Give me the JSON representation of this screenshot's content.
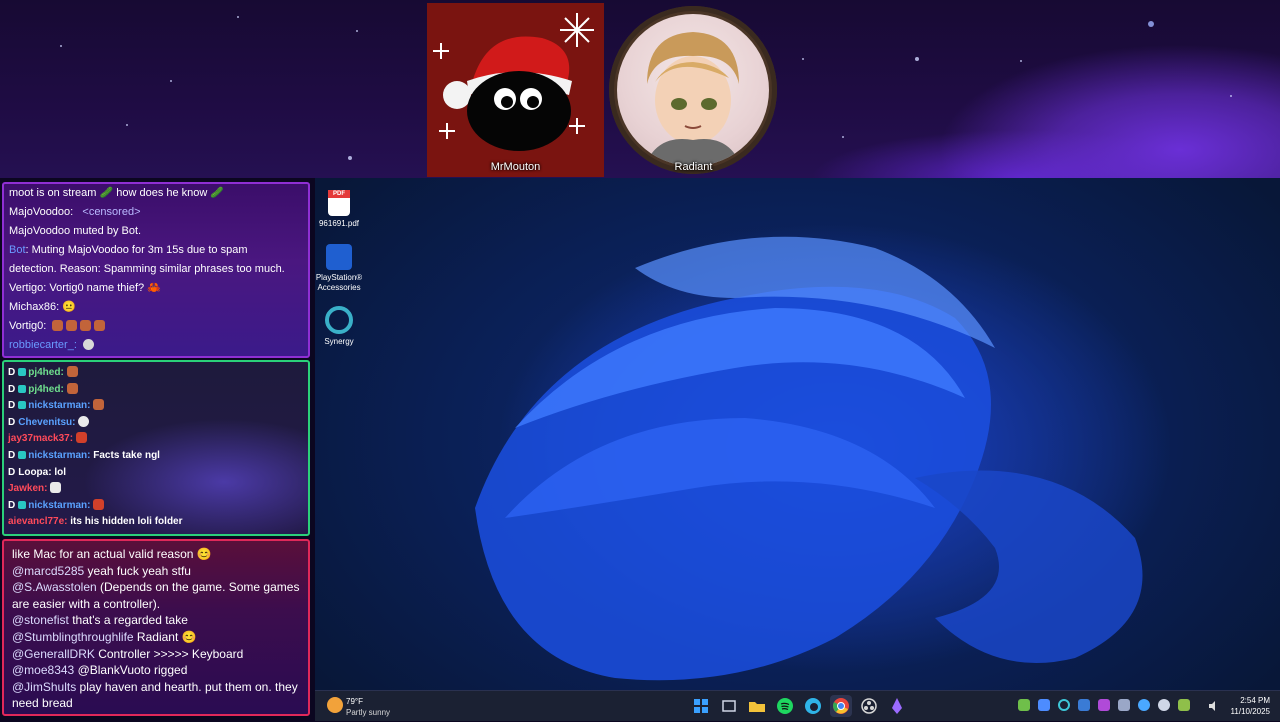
{
  "stream_overlay": {
    "cams": [
      {
        "name": "MrMouton"
      },
      {
        "name": "Radiant"
      }
    ]
  },
  "chat_top": {
    "lines": [
      {
        "text": "moot is on stream 🥒 how does he know 🥒"
      },
      {
        "user": "MajoVoodoo:",
        "message": "<censored>"
      },
      {
        "text": "MajoVoodoo muted by Bot."
      },
      {
        "user": "Bot",
        "message": ": Muting MajoVoodoo for 3m 15s due to spam"
      },
      {
        "text": "detection. Reason: Spamming similar phrases too much."
      },
      {
        "text": "Vertigo: Vortig0 name thief? 🦀"
      },
      {
        "text": "Michax86: 😐"
      },
      {
        "text": "Vortig0:"
      },
      {
        "text": "robbiecarter_:"
      }
    ]
  },
  "chat_mid": {
    "lines": [
      {
        "badge": "D",
        "name": "pj4hed:",
        "color": "green",
        "msg": ""
      },
      {
        "badge": "D",
        "name": "pj4hed:",
        "color": "green",
        "msg": ""
      },
      {
        "badge": "D",
        "name": "nickstarman:",
        "color": "blue",
        "msg": ""
      },
      {
        "badge": "D",
        "name": "Chevenitsu:",
        "color": "blue",
        "msg": ""
      },
      {
        "badge": "",
        "name": "jay37mack37:",
        "color": "red",
        "msg": ""
      },
      {
        "badge": "D",
        "name": "nickstarman:",
        "color": "blue",
        "msg": "Facts take ngl"
      },
      {
        "badge": "D",
        "name": "Loopa:",
        "color": "white",
        "msg": "lol"
      },
      {
        "badge": "",
        "name": "Jawken:",
        "color": "red",
        "msg": ""
      },
      {
        "badge": "D",
        "name": "nickstarman:",
        "color": "blue",
        "msg": ""
      },
      {
        "badge": "",
        "name": "aievancl77e:",
        "color": "red",
        "msg": "its his hidden loli folder"
      }
    ]
  },
  "chat_bottom": {
    "lines": [
      {
        "mention": "",
        "text": "like Mac for an actual valid reason 😊"
      },
      {
        "mention": "@marcd5285",
        "text": " yeah fuck yeah stfu"
      },
      {
        "mention": "@S.Awasstolen",
        "text": " (Depends on the game. Some games are easier with a controller)."
      },
      {
        "mention": "@stonefist",
        "text": " that's a regarded take"
      },
      {
        "mention": "@Stumblingthroughlife",
        "text": " Radiant 😊"
      },
      {
        "mention": "@GenerallDRK",
        "text": " Controller >>>>> Keyboard"
      },
      {
        "mention": "@moe8343",
        "text": " @BlankVuoto rigged"
      },
      {
        "mention": "@JimShults",
        "text": " play haven and hearth. put them on. they need bread"
      }
    ]
  },
  "desktop": {
    "icons": [
      {
        "label": "961691.pdf",
        "icon": "pdf-file-icon",
        "color": "#e43a3a"
      },
      {
        "label": "PlayStation® Accessories",
        "icon": "playstation-accessories-icon",
        "color": "#1f5fd0"
      },
      {
        "label": "Synergy",
        "icon": "synergy-icon",
        "color": "#3ab0c8"
      }
    ]
  },
  "taskbar": {
    "weather_temp": "79°F",
    "weather_cond": "Partly sunny",
    "apps": [
      {
        "name": "start-icon",
        "color": "#3aa0ff"
      },
      {
        "name": "task-view-icon",
        "color": "#cfd6e6"
      },
      {
        "name": "file-explorer-icon",
        "color": "#f2c23a"
      },
      {
        "name": "spotify-icon",
        "color": "#1ed760"
      },
      {
        "name": "edge-icon",
        "color": "#2fb4e8"
      },
      {
        "name": "chrome-icon",
        "color": "#e8453c"
      },
      {
        "name": "obs-icon",
        "color": "#d8d8d8"
      },
      {
        "name": "app-icon",
        "color": "#9b6bff"
      }
    ],
    "clock_time": "2:54 PM",
    "clock_date": "11/10/2025"
  }
}
